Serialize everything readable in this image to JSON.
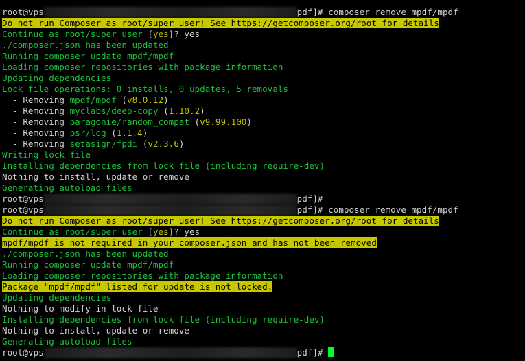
{
  "terminal": {
    "lines": [
      {
        "segments": [
          {
            "text": "root@vps",
            "cls": "w"
          },
          {
            "redacted": true
          },
          {
            "text": "pdf]# composer remove mpdf/mpdf",
            "cls": "w"
          }
        ]
      },
      {
        "segments": [
          {
            "text": "Do not run Composer as root/super user! See https://getcomposer.org/root for details",
            "cls": "hl"
          }
        ]
      },
      {
        "segments": [
          {
            "text": "Continue as root/super user ",
            "cls": "g"
          },
          {
            "text": "[",
            "cls": "w"
          },
          {
            "text": "yes",
            "cls": "y"
          },
          {
            "text": "]? yes",
            "cls": "w"
          }
        ]
      },
      {
        "segments": [
          {
            "text": "./composer.json has been updated",
            "cls": "g"
          }
        ]
      },
      {
        "segments": [
          {
            "text": "Running composer update mpdf/mpdf",
            "cls": "g"
          }
        ]
      },
      {
        "segments": [
          {
            "text": "Loading composer repositories with package information",
            "cls": "g"
          }
        ]
      },
      {
        "segments": [
          {
            "text": "Updating dependencies",
            "cls": "g"
          }
        ]
      },
      {
        "segments": [
          {
            "text": "Lock file operations: 0 installs, 0 updates, 5 removals",
            "cls": "g"
          }
        ]
      },
      {
        "segments": [
          {
            "text": "  - Removing ",
            "cls": "w"
          },
          {
            "text": "mpdf/mpdf",
            "cls": "g"
          },
          {
            "text": " (",
            "cls": "w"
          },
          {
            "text": "v8.0.12",
            "cls": "y"
          },
          {
            "text": ")",
            "cls": "w"
          }
        ]
      },
      {
        "segments": [
          {
            "text": "  - Removing ",
            "cls": "w"
          },
          {
            "text": "myclabs/deep-copy",
            "cls": "g"
          },
          {
            "text": " (",
            "cls": "w"
          },
          {
            "text": "1.10.2",
            "cls": "y"
          },
          {
            "text": ")",
            "cls": "w"
          }
        ]
      },
      {
        "segments": [
          {
            "text": "  - Removing ",
            "cls": "w"
          },
          {
            "text": "paragonie/random_compat",
            "cls": "g"
          },
          {
            "text": " (",
            "cls": "w"
          },
          {
            "text": "v9.99.100",
            "cls": "y"
          },
          {
            "text": ")",
            "cls": "w"
          }
        ]
      },
      {
        "segments": [
          {
            "text": "  - Removing ",
            "cls": "w"
          },
          {
            "text": "psr/log",
            "cls": "g"
          },
          {
            "text": " (",
            "cls": "w"
          },
          {
            "text": "1.1.4",
            "cls": "y"
          },
          {
            "text": ")",
            "cls": "w"
          }
        ]
      },
      {
        "segments": [
          {
            "text": "  - Removing ",
            "cls": "w"
          },
          {
            "text": "setasign/fpdi",
            "cls": "g"
          },
          {
            "text": " (",
            "cls": "w"
          },
          {
            "text": "v2.3.6",
            "cls": "y"
          },
          {
            "text": ")",
            "cls": "w"
          }
        ]
      },
      {
        "segments": [
          {
            "text": "Writing lock file",
            "cls": "g"
          }
        ]
      },
      {
        "segments": [
          {
            "text": "Installing dependencies from lock file (including require-dev)",
            "cls": "g"
          }
        ]
      },
      {
        "segments": [
          {
            "text": "Nothing to install, update or remove",
            "cls": "w"
          }
        ]
      },
      {
        "segments": [
          {
            "text": "Generating autoload files",
            "cls": "g"
          }
        ]
      },
      {
        "segments": [
          {
            "text": "root@vps",
            "cls": "w"
          },
          {
            "redacted": true
          },
          {
            "text": "pdf]#",
            "cls": "w"
          }
        ]
      },
      {
        "segments": [
          {
            "text": "root@vps",
            "cls": "w"
          },
          {
            "redacted": true
          },
          {
            "text": "pdf]# composer remove mpdf/mpdf",
            "cls": "w"
          }
        ]
      },
      {
        "segments": [
          {
            "text": "Do not run Composer as root/super user! See https://getcomposer.org/root for details",
            "cls": "hl"
          }
        ]
      },
      {
        "segments": [
          {
            "text": "Continue as root/super user ",
            "cls": "g"
          },
          {
            "text": "[",
            "cls": "w"
          },
          {
            "text": "yes",
            "cls": "y"
          },
          {
            "text": "]? yes",
            "cls": "w"
          }
        ]
      },
      {
        "segments": [
          {
            "text": "mpdf/mpdf is not required in your composer.json and has not been removed",
            "cls": "hl"
          }
        ]
      },
      {
        "segments": [
          {
            "text": "./composer.json has been updated",
            "cls": "g"
          }
        ]
      },
      {
        "segments": [
          {
            "text": "Running composer update mpdf/mpdf",
            "cls": "g"
          }
        ]
      },
      {
        "segments": [
          {
            "text": "Loading composer repositories with package information",
            "cls": "g"
          }
        ]
      },
      {
        "segments": [
          {
            "text": "Package \"mpdf/mpdf\" listed for update is not locked.",
            "cls": "hl"
          }
        ]
      },
      {
        "segments": [
          {
            "text": "Updating dependencies",
            "cls": "g"
          }
        ]
      },
      {
        "segments": [
          {
            "text": "Nothing to modify in lock file",
            "cls": "w"
          }
        ]
      },
      {
        "segments": [
          {
            "text": "Installing dependencies from lock file (including require-dev)",
            "cls": "g"
          }
        ]
      },
      {
        "segments": [
          {
            "text": "Nothing to install, update or remove",
            "cls": "w"
          }
        ]
      },
      {
        "segments": [
          {
            "text": "Generating autoload files",
            "cls": "g"
          }
        ]
      },
      {
        "segments": [
          {
            "text": "root@vps",
            "cls": "w"
          },
          {
            "redacted": true
          },
          {
            "text": "pdf]# ",
            "cls": "w"
          },
          {
            "cursor": true
          }
        ]
      }
    ],
    "colors": {
      "background": "#000000",
      "success_text": "#1fbf3c",
      "plain_text": "#d0d0d0",
      "version_text": "#bfbf00",
      "warning_highlight": "#c8c800",
      "cursor": "#00ff2a"
    }
  }
}
